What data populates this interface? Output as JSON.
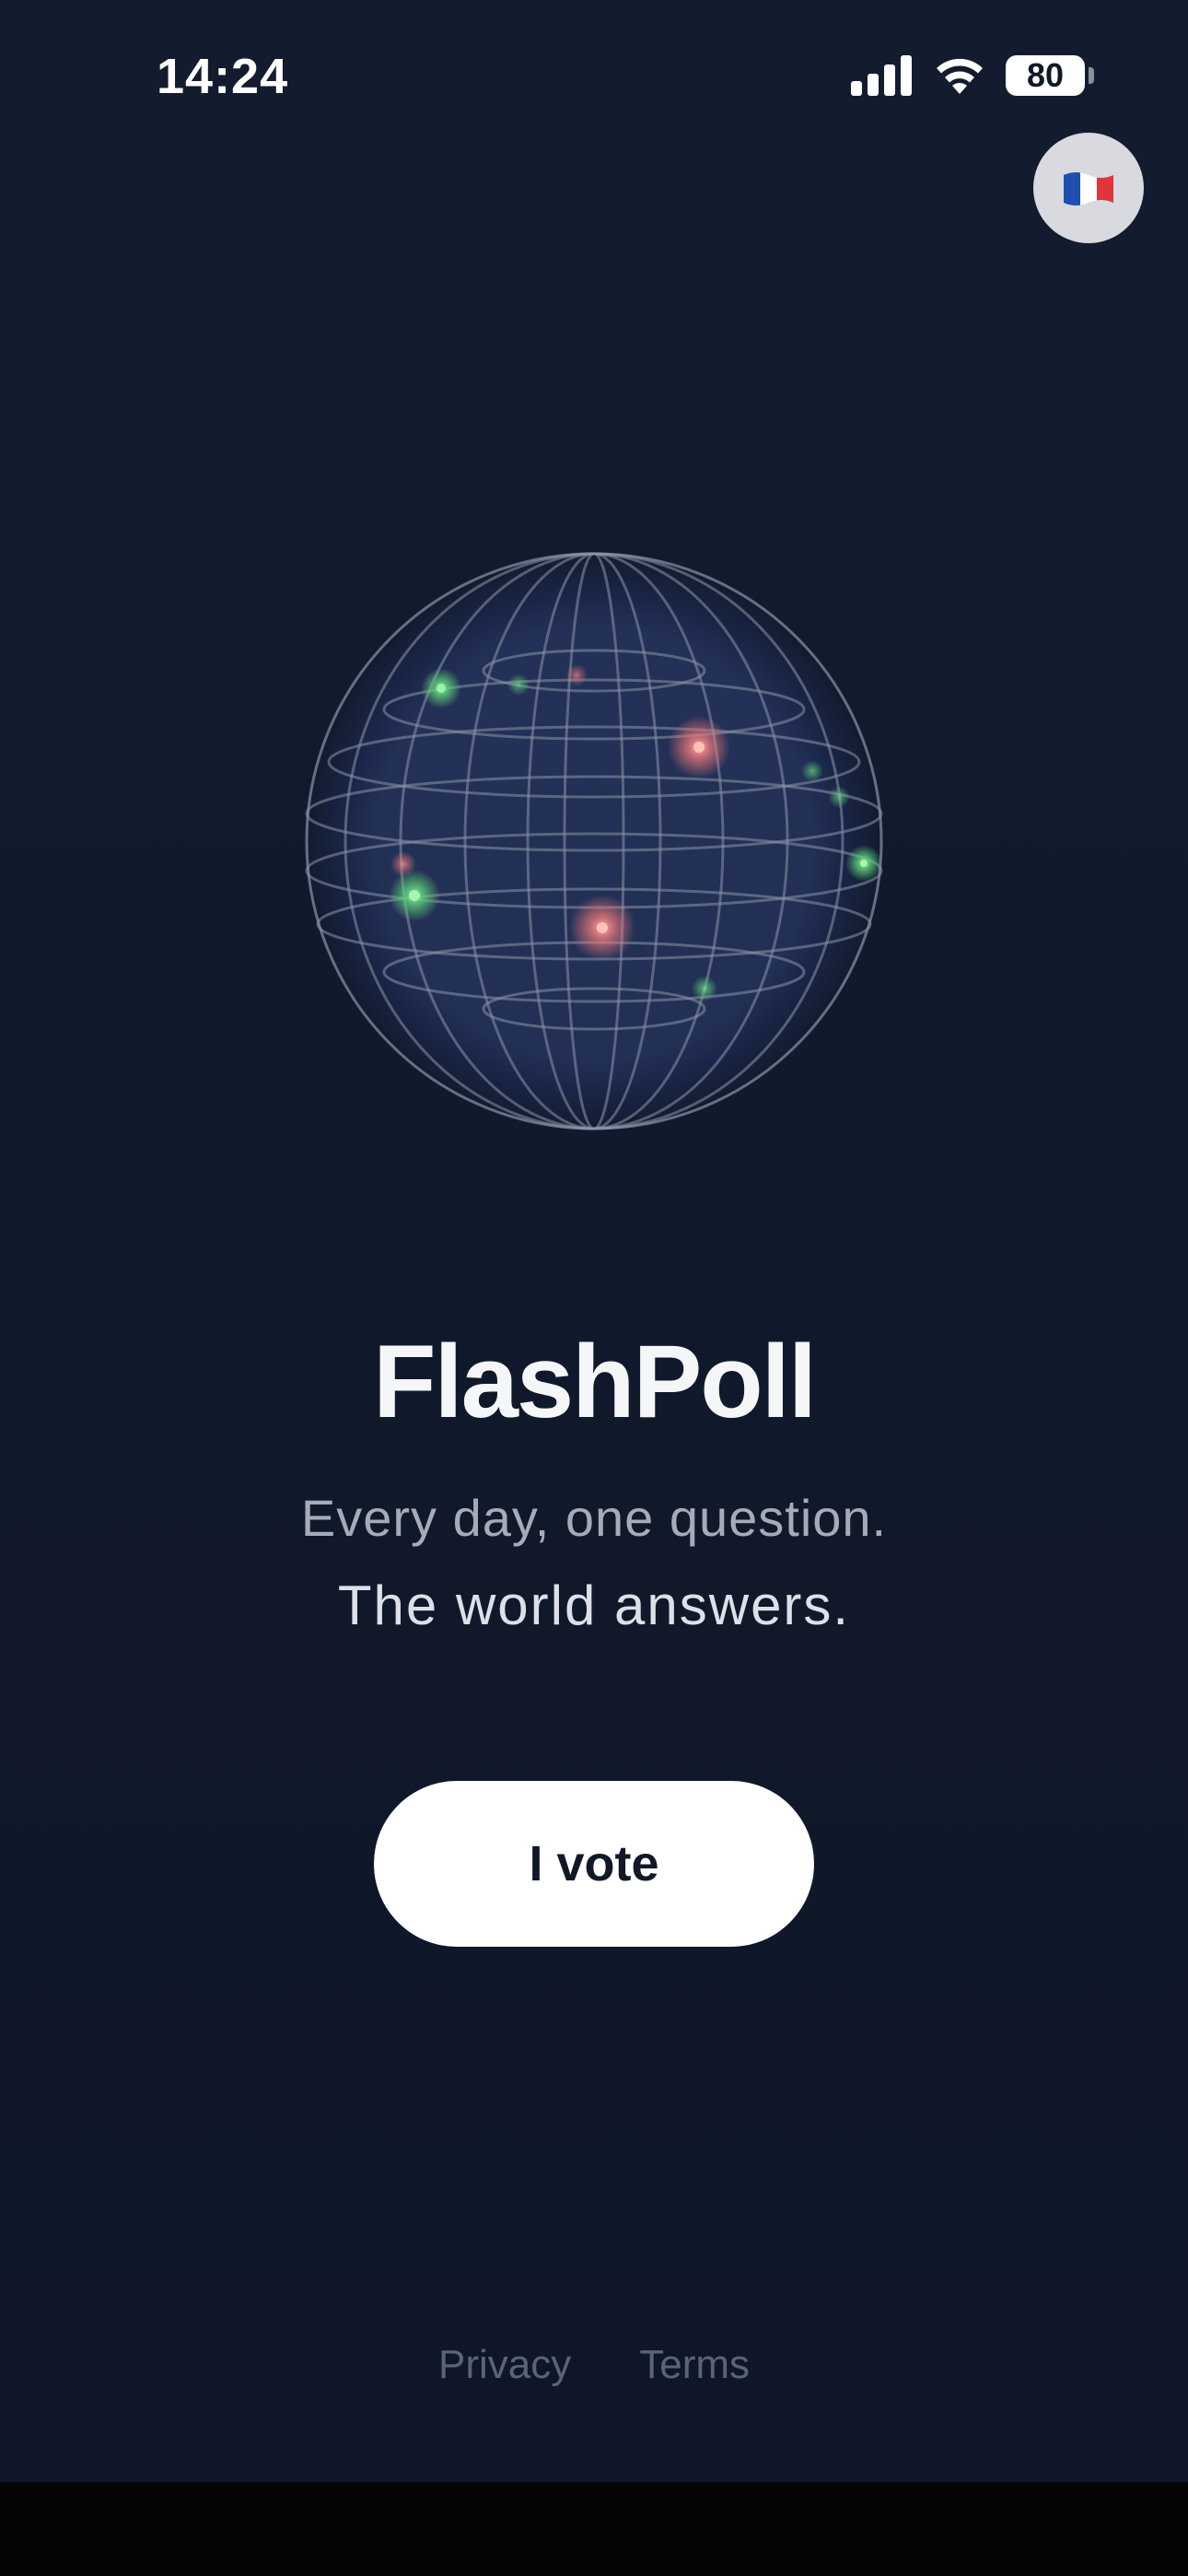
{
  "status_bar": {
    "time": "14:24",
    "battery_level": "80",
    "icons": [
      "signal-icon",
      "wifi-icon",
      "battery-icon"
    ]
  },
  "language_button": {
    "icon": "french-flag-icon",
    "colors": {
      "blue": "#1f4fb0",
      "white": "#ffffff",
      "red": "#e0353b"
    }
  },
  "hero": {
    "illustration": "globe-icon",
    "title": "FlashPoll",
    "tagline_line1": "Every day, one question.",
    "tagline_line2": "The world answers."
  },
  "cta": {
    "label": "I vote"
  },
  "footer": {
    "links": [
      {
        "label": "Privacy"
      },
      {
        "label": "Terms"
      }
    ]
  },
  "theme": {
    "background": "#111a2c",
    "accent_green": "#5fd17a",
    "accent_red": "#f07a7a",
    "button_bg": "#ffffff"
  }
}
